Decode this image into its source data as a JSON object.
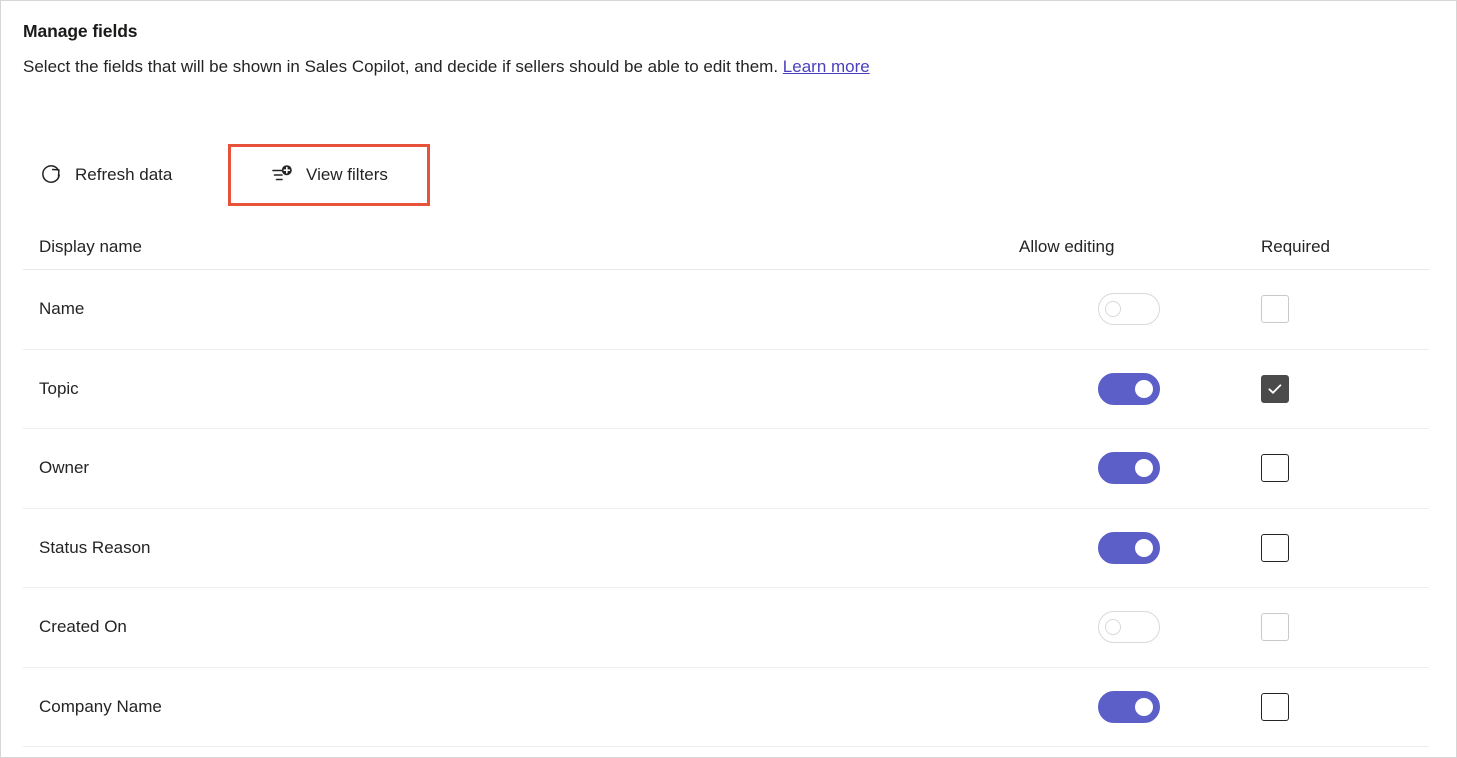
{
  "page": {
    "title": "Manage fields",
    "subtitle_text": "Select the fields that will be shown in Sales Copilot, and decide if sellers should be able to edit them.",
    "learn_more_label": "Learn more"
  },
  "toolbar": {
    "refresh_label": "Refresh data",
    "refresh_icon": "refresh-icon",
    "view_filters_label": "View filters",
    "view_filters_icon": "filter-add-icon",
    "highlight_color": "#e8513a"
  },
  "table": {
    "columns": {
      "display_name": "Display name",
      "allow_editing": "Allow editing",
      "required": "Required"
    },
    "rows": [
      {
        "name": "Name",
        "allow_editing": false,
        "allow_editing_disabled": true,
        "required": false,
        "required_disabled": true
      },
      {
        "name": "Topic",
        "allow_editing": true,
        "allow_editing_disabled": false,
        "required": true,
        "required_disabled": false
      },
      {
        "name": "Owner",
        "allow_editing": true,
        "allow_editing_disabled": false,
        "required": false,
        "required_disabled": false
      },
      {
        "name": "Status Reason",
        "allow_editing": true,
        "allow_editing_disabled": false,
        "required": false,
        "required_disabled": false
      },
      {
        "name": "Created On",
        "allow_editing": false,
        "allow_editing_disabled": true,
        "required": false,
        "required_disabled": true
      },
      {
        "name": "Company Name",
        "allow_editing": true,
        "allow_editing_disabled": false,
        "required": false,
        "required_disabled": false
      }
    ]
  },
  "colors": {
    "toggle_on": "#5b5fc7",
    "checkbox_checked": "#4b4b4b",
    "link": "#4b3fbd"
  }
}
